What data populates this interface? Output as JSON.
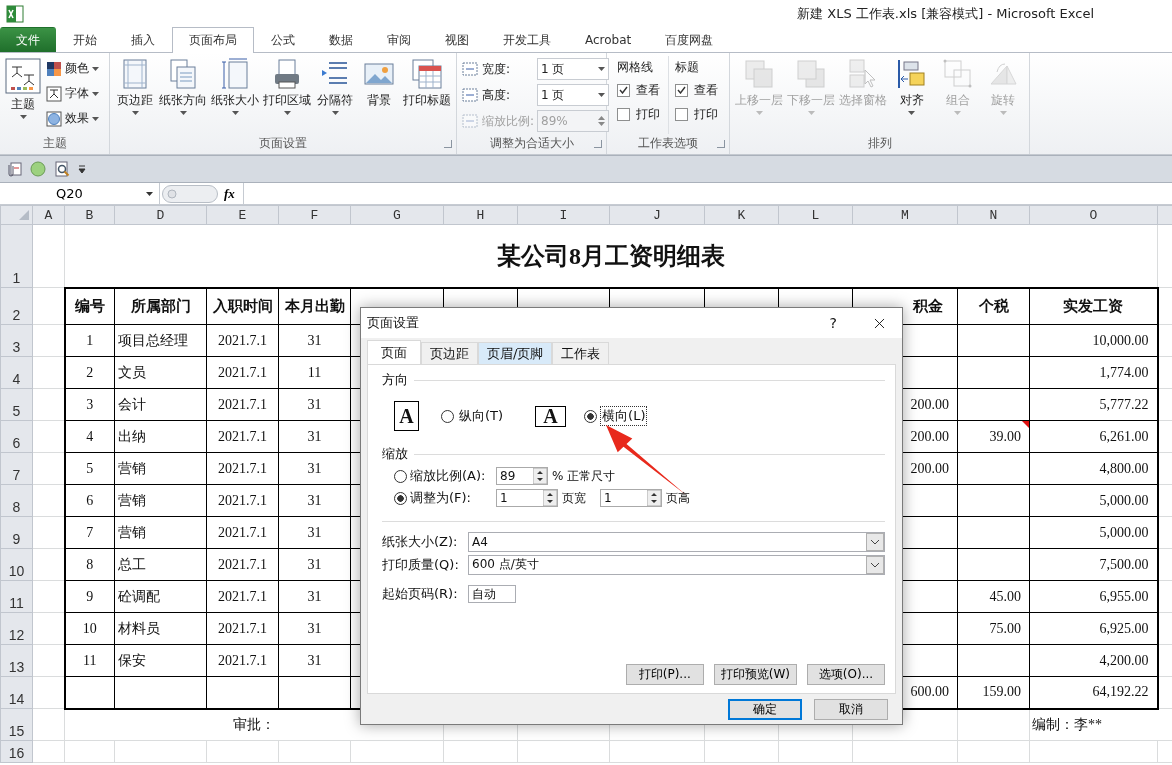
{
  "window": {
    "title": "新建 XLS 工作表.xls  [兼容模式]  -  Microsoft Excel"
  },
  "ribbon_tabs": [
    {
      "label": "文件",
      "kind": "file",
      "selected": false
    },
    {
      "label": "开始",
      "kind": "tab",
      "selected": false
    },
    {
      "label": "插入",
      "kind": "tab",
      "selected": false
    },
    {
      "label": "页面布局",
      "kind": "tab",
      "selected": true
    },
    {
      "label": "公式",
      "kind": "tab",
      "selected": false
    },
    {
      "label": "数据",
      "kind": "tab",
      "selected": false
    },
    {
      "label": "审阅",
      "kind": "tab",
      "selected": false
    },
    {
      "label": "视图",
      "kind": "tab",
      "selected": false
    },
    {
      "label": "开发工具",
      "kind": "tab",
      "selected": false
    },
    {
      "label": "Acrobat",
      "kind": "tab",
      "selected": false
    },
    {
      "label": "百度网盘",
      "kind": "tab",
      "selected": false
    }
  ],
  "ribbon_groups": [
    {
      "kind": "theme",
      "label": "主题",
      "launcher": false,
      "main": "主题",
      "items": [
        "颜色",
        "字体",
        "效果"
      ]
    },
    {
      "kind": "large_buttons",
      "label": "页面设置",
      "launcher": true,
      "buttons": [
        {
          "label": "页边距",
          "dropdown": true,
          "disabled": false
        },
        {
          "label": "纸张方向",
          "dropdown": true,
          "disabled": false
        },
        {
          "label": "纸张大小",
          "dropdown": true,
          "disabled": false
        },
        {
          "label": "打印区域",
          "dropdown": true,
          "disabled": false
        },
        {
          "label": "分隔符",
          "dropdown": true,
          "disabled": false
        },
        {
          "label": "背景",
          "dropdown": false,
          "disabled": false
        },
        {
          "label": "打印标题",
          "dropdown": false,
          "disabled": false
        }
      ]
    },
    {
      "kind": "scale",
      "label": "调整为合适大小",
      "launcher": true,
      "rows": [
        {
          "kind": "dropdown",
          "label": "宽度:",
          "value": "1 页",
          "disabled": false
        },
        {
          "kind": "dropdown",
          "label": "高度:",
          "value": "1 页",
          "disabled": false
        },
        {
          "kind": "spin",
          "label": "缩放比例:",
          "value": "89%",
          "disabled": true
        }
      ]
    },
    {
      "kind": "sheet_options",
      "label": "工作表选项",
      "launcher": true,
      "columns": [
        {
          "title": "网格线",
          "options": [
            {
              "label": "查看",
              "checked": true
            },
            {
              "label": "打印",
              "checked": false
            }
          ]
        },
        {
          "title": "标题",
          "options": [
            {
              "label": "查看",
              "checked": true
            },
            {
              "label": "打印",
              "checked": false
            }
          ]
        }
      ]
    },
    {
      "kind": "large_buttons",
      "label": "排列",
      "launcher": false,
      "buttons": [
        {
          "label": "上移一层",
          "dropdown": true,
          "disabled": true
        },
        {
          "label": "下移一层",
          "dropdown": true,
          "disabled": true
        },
        {
          "label": "选择窗格",
          "dropdown": false,
          "disabled": true
        },
        {
          "label": "对齐",
          "dropdown": true,
          "disabled": false
        },
        {
          "label": "组合",
          "dropdown": true,
          "disabled": true
        },
        {
          "label": "旋转",
          "dropdown": true,
          "disabled": true
        }
      ]
    }
  ],
  "formula_bar": {
    "name_box": "Q20",
    "fx": "fx"
  },
  "sheet": {
    "columns": [
      "A",
      "B",
      "D",
      "E",
      "F",
      "G",
      "H",
      "I",
      "J",
      "K",
      "L",
      "M",
      "N",
      "O"
    ],
    "rows": [
      "1",
      "2",
      "3",
      "4",
      "5",
      "6",
      "7",
      "8",
      "9",
      "10",
      "11",
      "12",
      "13",
      "14",
      "15",
      "16"
    ],
    "title": "某公司8月工资明细表",
    "headers": [
      "编号",
      "所属部门",
      "入职时间",
      "本月出勤",
      "积金",
      "个税",
      "实发工资"
    ],
    "records": [
      {
        "no": "1",
        "dept": "项目总经理",
        "date": "2021.7.1",
        "days": "31",
        "net": "10,000.00",
        "comment": false
      },
      {
        "no": "2",
        "dept": "文员",
        "date": "2021.7.1",
        "days": "11",
        "net": "1,774.00",
        "comment": false
      },
      {
        "no": "3",
        "dept": "会计",
        "date": "2021.7.1",
        "days": "31",
        "fund": "200.00",
        "net": "5,777.22",
        "comment": false
      },
      {
        "no": "4",
        "dept": "出纳",
        "date": "2021.7.1",
        "days": "31",
        "fund": "200.00",
        "tax": "39.00",
        "net": "6,261.00",
        "comment": true
      },
      {
        "no": "5",
        "dept": "营销",
        "date": "2021.7.1",
        "days": "31",
        "fund": "200.00",
        "net": "4,800.00",
        "comment": false
      },
      {
        "no": "6",
        "dept": "营销",
        "date": "2021.7.1",
        "days": "31",
        "net": "5,000.00",
        "comment": false
      },
      {
        "no": "7",
        "dept": "营销",
        "date": "2021.7.1",
        "days": "31",
        "net": "5,000.00",
        "comment": false
      },
      {
        "no": "8",
        "dept": "总工",
        "date": "2021.7.1",
        "days": "31",
        "net": "7,500.00",
        "comment": false
      },
      {
        "no": "9",
        "dept": "砼调配",
        "date": "2021.7.1",
        "days": "31",
        "tax": "45.00",
        "net": "6,955.00",
        "comment": false
      },
      {
        "no": "10",
        "dept": "材料员",
        "date": "2021.7.1",
        "days": "31",
        "tax": "75.00",
        "net": "6,925.00",
        "comment": false
      },
      {
        "no": "11",
        "dept": "保安",
        "date": "2021.7.1",
        "days": "31",
        "net": "4,200.00",
        "comment": false
      }
    ],
    "total": {
      "fund": "600.00",
      "tax": "159.00",
      "net": "64,192.22"
    },
    "footer": [
      "审批：",
      "编制：李**"
    ]
  },
  "dialog": {
    "title": "页面设置",
    "help": "?",
    "tabs": [
      {
        "label": "页面",
        "selected": true,
        "hovered": false
      },
      {
        "label": "页边距",
        "selected": false,
        "hovered": false
      },
      {
        "label": "页眉/页脚",
        "selected": false,
        "hovered": true
      },
      {
        "label": "工作表",
        "selected": false,
        "hovered": false
      }
    ],
    "orientation": {
      "title": "方向",
      "options": [
        {
          "glyph": "A",
          "label": "纵向(T)",
          "selected": false,
          "focused": false
        },
        {
          "glyph": "A",
          "label": "横向(L)",
          "selected": true,
          "focused": true
        }
      ]
    },
    "scaling": {
      "title": "缩放",
      "options": [
        {
          "kind": "percent",
          "label": "缩放比例(A):",
          "selected": false,
          "value": "89",
          "suffix": "% 正常尺寸"
        },
        {
          "kind": "fit",
          "label": "调整为(F):",
          "selected": true,
          "wide": "1",
          "wide_label": "页宽",
          "tall": "1",
          "tall_label": "页高"
        }
      ]
    },
    "fields": [
      {
        "kind": "select",
        "label": "纸张大小(Z):",
        "value": "A4"
      },
      {
        "kind": "select",
        "label": "打印质量(Q):",
        "value": "600 点/英寸"
      },
      {
        "kind": "text",
        "label": "起始页码(R):",
        "value": "自动"
      }
    ],
    "actions": [
      "打印(P)...",
      "打印预览(W)",
      "选项(O)..."
    ],
    "buttons": [
      {
        "label": "确定",
        "default": true
      },
      {
        "label": "取消",
        "default": false
      }
    ]
  }
}
